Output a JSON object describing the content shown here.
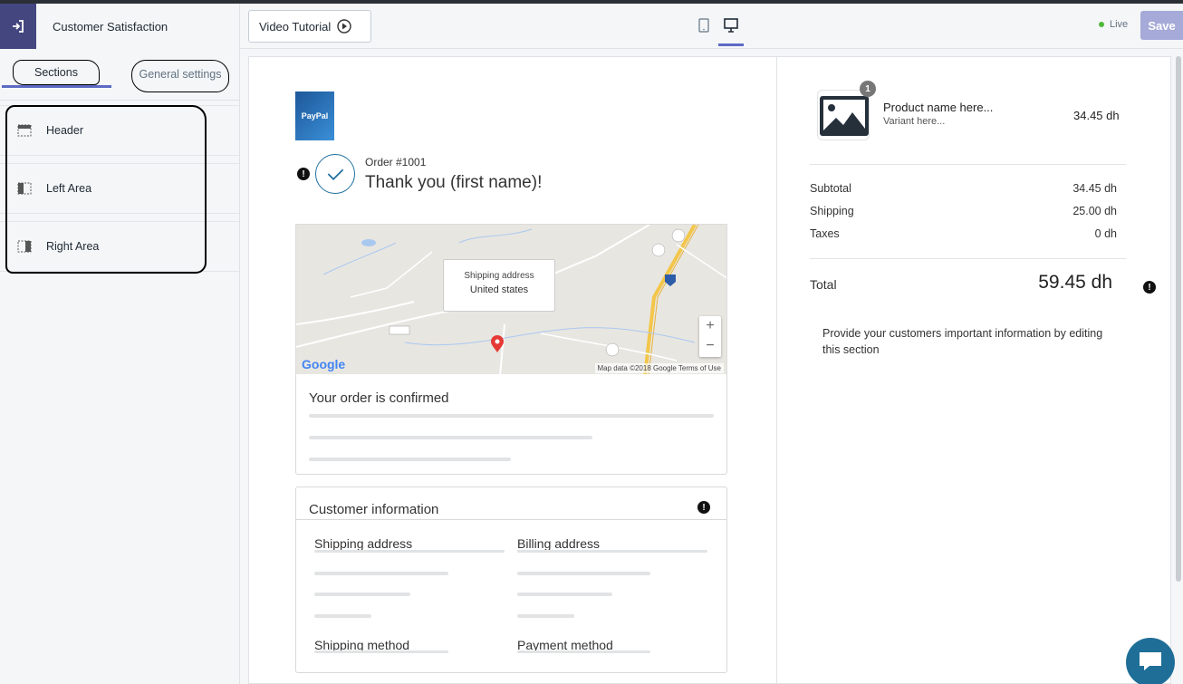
{
  "sidebar": {
    "app_title": "Customer Satisfaction",
    "tabs": [
      {
        "label": "Sections"
      },
      {
        "label": "General settings"
      }
    ],
    "sections": [
      {
        "label": "Header"
      },
      {
        "label": "Left Area"
      },
      {
        "label": "Right Area"
      }
    ]
  },
  "topbar": {
    "video_tutorial_label": "Video Tutorial",
    "live_label": "Live",
    "save_label": "Save"
  },
  "preview": {
    "logo_text": "PayPal",
    "order_number": "Order #1001",
    "thank_you": "Thank you (first name)!",
    "map": {
      "popup_title": "Shipping address",
      "popup_value": "United states",
      "zoom_in": "+",
      "zoom_out": "−",
      "google_label": "Google",
      "credits": "Map data ©2018 Google   Terms of Use"
    },
    "confirmed_title": "Your order is confirmed",
    "customer_info": {
      "title": "Customer information",
      "shipping_address": "Shipping address",
      "billing_address": "Billing address",
      "shipping_method": "Shipping method",
      "payment_method": "Payment method"
    },
    "summary": {
      "qty": "1",
      "product_name": "Product name here...",
      "variant": "Variant here...",
      "product_price": "34.45 dh",
      "subtotal_label": "Subtotal",
      "subtotal_value": "34.45 dh",
      "shipping_label": "Shipping",
      "shipping_value": "25.00 dh",
      "taxes_label": "Taxes",
      "taxes_value": "0 dh",
      "total_label": "Total",
      "total_value": "59.45 dh",
      "info_text": "Provide your customers important information by editing this section"
    }
  },
  "colors": {
    "accent": "#5c6ac4",
    "exit_bg": "#43467f",
    "save_bg": "#a5aad8",
    "live_dot": "#50b83c",
    "check": "#1e6f9f",
    "chat": "#1f6e97"
  }
}
